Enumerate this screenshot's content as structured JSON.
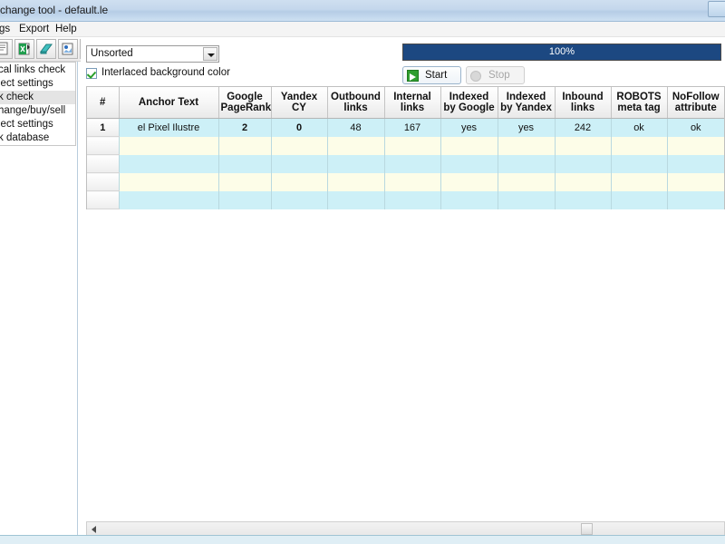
{
  "window": {
    "title": "change tool - default.le",
    "close_label": ""
  },
  "menu": {
    "items": [
      {
        "label": "gs"
      },
      {
        "label": "Export"
      },
      {
        "label": "Help"
      }
    ]
  },
  "toolbar": {
    "buttons": [
      {
        "name": "new-document-icon"
      },
      {
        "name": "export-excel-icon"
      },
      {
        "name": "book-icon"
      },
      {
        "name": "import-icon"
      },
      {
        "name": "print-icon"
      }
    ]
  },
  "sidebar": {
    "items": [
      {
        "label": "cal links check",
        "selected": false
      },
      {
        "label": "ject settings",
        "selected": false
      },
      {
        "label": "k check",
        "selected": true
      },
      {
        "label": "hange/buy/sell",
        "selected": false
      },
      {
        "label": "ject settings",
        "selected": false
      },
      {
        "label": "k database",
        "selected": false
      }
    ]
  },
  "controls": {
    "sort": {
      "value": "Unsorted",
      "options": [
        "Unsorted"
      ]
    },
    "interlaced_checkbox": {
      "label": "Interlaced background color",
      "checked": true
    },
    "progress": {
      "percent": 100,
      "text": "100%",
      "fill_color": "#1c4881"
    },
    "start_button": {
      "label": "Start",
      "enabled": true
    },
    "stop_button": {
      "label": "Stop",
      "enabled": false
    }
  },
  "grid": {
    "columns": [
      {
        "label": "#",
        "width": 35
      },
      {
        "label": "Anchor Text",
        "width": 110
      },
      {
        "label": "Google\nPageRank",
        "line1": "Google",
        "line2": "PageRank",
        "width": 58
      },
      {
        "label": "Yandex CY",
        "line1": "Yandex CY",
        "line2": "",
        "width": 62
      },
      {
        "label": "Outbound links",
        "line1": "Outbound",
        "line2": "links",
        "width": 63
      },
      {
        "label": "Internal links",
        "line1": "Internal",
        "line2": "links",
        "width": 62
      },
      {
        "label": "Indexed by Google",
        "line1": "Indexed",
        "line2": "by Google",
        "width": 63
      },
      {
        "label": "Indexed by Yandex",
        "line1": "Indexed",
        "line2": "by Yandex",
        "width": 63
      },
      {
        "label": "Inbound links",
        "line1": "Inbound",
        "line2": "links",
        "width": 62
      },
      {
        "label": "ROBOTS meta tag",
        "line1": "ROBOTS",
        "line2": "meta tag",
        "width": 62
      },
      {
        "label": "NoFollow attribute",
        "line1": "NoFollow",
        "line2": "attribute",
        "width": 63
      }
    ],
    "rows": [
      {
        "num": "1",
        "anchor_text": "el Pixel Ilustre",
        "google_pagerank": "2",
        "yandex_cy": "0",
        "outbound_links": "48",
        "internal_links": "167",
        "indexed_by_google": "yes",
        "indexed_by_yandex": "yes",
        "inbound_links": "242",
        "robots_meta_tag": "ok",
        "nofollow_attribute": "ok"
      },
      {
        "num": "",
        "anchor_text": "",
        "google_pagerank": "",
        "yandex_cy": "",
        "outbound_links": "",
        "internal_links": "",
        "indexed_by_google": "",
        "indexed_by_yandex": "",
        "inbound_links": "",
        "robots_meta_tag": "",
        "nofollow_attribute": ""
      },
      {
        "num": "",
        "anchor_text": "",
        "google_pagerank": "",
        "yandex_cy": "",
        "outbound_links": "",
        "internal_links": "",
        "indexed_by_google": "",
        "indexed_by_yandex": "",
        "inbound_links": "",
        "robots_meta_tag": "",
        "nofollow_attribute": ""
      },
      {
        "num": "",
        "anchor_text": "",
        "google_pagerank": "",
        "yandex_cy": "",
        "outbound_links": "",
        "internal_links": "",
        "indexed_by_google": "",
        "indexed_by_yandex": "",
        "inbound_links": "",
        "robots_meta_tag": "",
        "nofollow_attribute": ""
      },
      {
        "num": "",
        "anchor_text": "",
        "google_pagerank": "",
        "yandex_cy": "",
        "outbound_links": "",
        "internal_links": "",
        "indexed_by_google": "",
        "indexed_by_yandex": "",
        "inbound_links": "",
        "robots_meta_tag": "",
        "nofollow_attribute": ""
      }
    ]
  },
  "colors": {
    "row_odd": "#cdf0f7",
    "row_even": "#fdfde8",
    "progress": "#1c4881",
    "titlebar": "#c4d7ec"
  }
}
